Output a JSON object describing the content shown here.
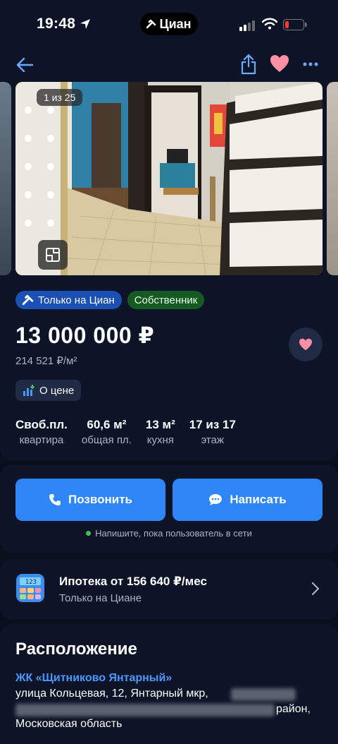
{
  "status": {
    "time": "19:48",
    "island_label": "Циан"
  },
  "gallery": {
    "counter": "1 из 25"
  },
  "badges": {
    "cian_only": "Только на Циан",
    "owner": "Собственник"
  },
  "listing": {
    "price": "13 000 000 ₽",
    "price_per_sqm": "214 521 ₽/м²",
    "price_info": "О цене",
    "specs": [
      {
        "value": "Своб.пл.",
        "label": "квартира"
      },
      {
        "value": "60,6 м²",
        "label": "общая пл."
      },
      {
        "value": "13 м²",
        "label": "кухня"
      },
      {
        "value": "17 из 17",
        "label": "этаж"
      }
    ]
  },
  "contact": {
    "call_label": "Позвонить",
    "write_label": "Написать",
    "online_text": "Напишите, пока пользователь в сети"
  },
  "mortgage": {
    "title": "Ипотека от 156 640 ₽/мес",
    "subtitle": "Только на Циане",
    "calc_display": "123"
  },
  "location": {
    "title": "Расположение",
    "complex": "ЖК «Щитниково Янтарный»",
    "address_line1": "улица Кольцевая, 12, Янтарный мкр,",
    "address_line2_tail": "район,",
    "address_line3": "Московская область"
  },
  "colors": {
    "background": "#0a0f1e",
    "card": "#0d1427",
    "accent": "#2f86f6",
    "favorite": "#ff8fa3"
  }
}
